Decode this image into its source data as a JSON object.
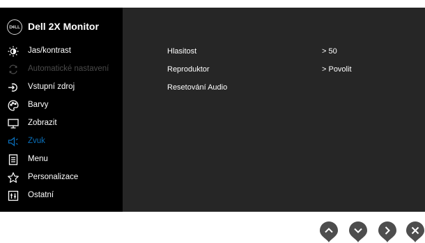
{
  "osd": {
    "logo_text": "D¢LL",
    "title": "Dell 2X Monitor",
    "menu": [
      {
        "label": "Jas/kontrast",
        "icon": "brightness-icon"
      },
      {
        "label": "Automatické nastavení",
        "icon": "auto-adjust-icon",
        "state": "disabled"
      },
      {
        "label": "Vstupní zdroj",
        "icon": "input-source-icon"
      },
      {
        "label": "Barvy",
        "icon": "color-palette-icon"
      },
      {
        "label": "Zobrazit",
        "icon": "display-monitor-icon"
      },
      {
        "label": "Zvuk",
        "icon": "speaker-icon",
        "state": "selected"
      },
      {
        "label": "Menu",
        "icon": "menu-document-icon"
      },
      {
        "label": "Personalizace",
        "icon": "star-icon"
      },
      {
        "label": "Ostatní",
        "icon": "others-icon"
      }
    ],
    "audio_settings": [
      {
        "label": "Hlasitost",
        "value": ">  50"
      },
      {
        "label": "Reproduktor",
        "value": ">  Povolit"
      },
      {
        "label": "Resetování Audio",
        "value": ""
      }
    ]
  },
  "nav_buttons": [
    {
      "icon": "chevron-up-icon"
    },
    {
      "icon": "chevron-down-icon"
    },
    {
      "icon": "chevron-right-icon"
    },
    {
      "icon": "close-icon"
    }
  ],
  "colors": {
    "sidebar_bg": "#000000",
    "panel_bg": "#262626",
    "selected_accent": "#0a6fba",
    "disabled_text": "#4a4a4a",
    "nav_button": "#4d4d4d"
  }
}
